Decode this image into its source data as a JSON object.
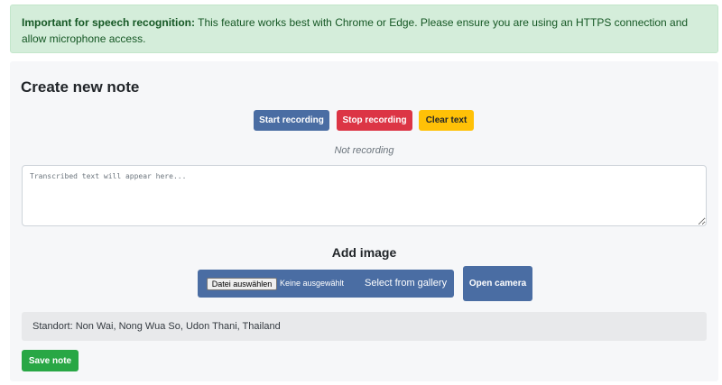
{
  "alert": {
    "strong": "Important for speech recognition:",
    "text": " This feature works best with Chrome or Edge. Please ensure you are using an HTTPS connection and allow microphone access."
  },
  "card": {
    "title": "Create new note",
    "buttons": {
      "start": "Start recording",
      "stop": "Stop recording",
      "clear": "Clear text"
    },
    "recording_status": "Not recording",
    "transcript": {
      "placeholder": "Transcribed text will appear here...",
      "value": ""
    },
    "image": {
      "heading": "Add image",
      "file_button": "Datei auswählen",
      "file_status": "Keine ausgewählt",
      "gallery_label": "Select from gallery",
      "camera_button": "Open camera"
    },
    "location": "Standort: Non Wai, Nong Wua So, Udon Thani, Thailand",
    "save_button": "Save note"
  },
  "colors": {
    "primary": "#4a6da3",
    "danger": "#dc3545",
    "warning": "#ffc107",
    "success": "#28a745",
    "alert_bg": "#d4edda",
    "alert_text": "#155724"
  }
}
